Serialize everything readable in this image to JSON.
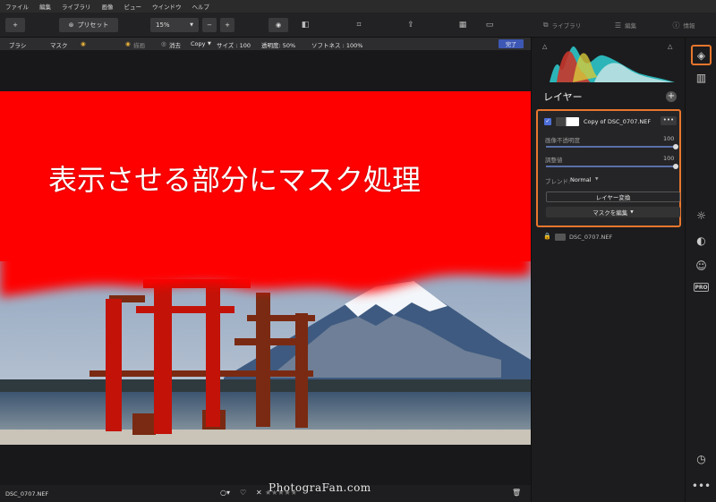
{
  "menu": [
    "ファイル",
    "編集",
    "ライブラリ",
    "画像",
    "ビュー",
    "ウインドウ",
    "ヘルプ"
  ],
  "toolbar": {
    "preset_label": "プリセット",
    "zoom": "15%",
    "library_label": "ライブラリ",
    "edit_label": "編集",
    "info_label": "情報"
  },
  "options": {
    "brush": "ブラシ",
    "mask": "マスク",
    "paint": "描画",
    "erase": "消去",
    "copy": "Copy",
    "size": "サイズ : 100",
    "opacity": "透明度: 50%",
    "softness": "ソフトネス : 100%",
    "done": "完了"
  },
  "canvas": {
    "overlay_text": "表示させる部分にマスク処理",
    "mask_color": "#ff0000"
  },
  "status": {
    "filename": "DSC_0707.NEF",
    "stars": "★★★★★",
    "watermark": "PhotograFan.com"
  },
  "layers": {
    "title": "レイヤー",
    "active_layer": {
      "name": "Copy of DSC_0707.NEF",
      "image_opacity_label": "画像不透明度",
      "image_opacity_value": "100",
      "adjust_label": "調整値",
      "adjust_value": "100",
      "blend_label": "ブレンド:",
      "blend_value": "Normal",
      "convert_button": "レイヤー変換",
      "edit_mask_button": "マスクを編集"
    },
    "base_layer": {
      "name": "DSC_0707.NEF"
    }
  },
  "colors": {
    "accent_orange": "#e8762d",
    "done_blue": "#3d58b4"
  }
}
